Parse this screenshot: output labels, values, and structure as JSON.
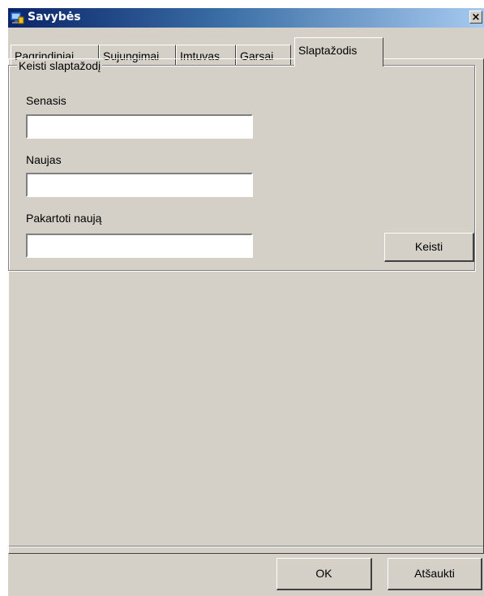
{
  "window": {
    "title": "Savybės",
    "close_label": "×"
  },
  "tabs": [
    {
      "label": "Pagrindiniai",
      "active": false
    },
    {
      "label": "Sujungimai",
      "active": false
    },
    {
      "label": "Imtuvas",
      "active": false
    },
    {
      "label": "Garsai",
      "active": false
    },
    {
      "label": "Slaptažodis",
      "active": true
    }
  ],
  "password_group": {
    "title": "Keisti slaptažodį",
    "old_label": "Senasis",
    "old_value": "",
    "new_label": "Naujas",
    "new_value": "",
    "repeat_label": "Pakartoti naują",
    "repeat_value": "",
    "change_button": "Keisti"
  },
  "footer": {
    "ok_button": "OK",
    "cancel_button": "Atšaukti"
  },
  "colors": {
    "dialog_face": "#d4d0c8",
    "title_start": "#0a246a",
    "title_end": "#a6caf0"
  },
  "icons": {
    "app": "computer-icon",
    "close": "close-icon"
  }
}
